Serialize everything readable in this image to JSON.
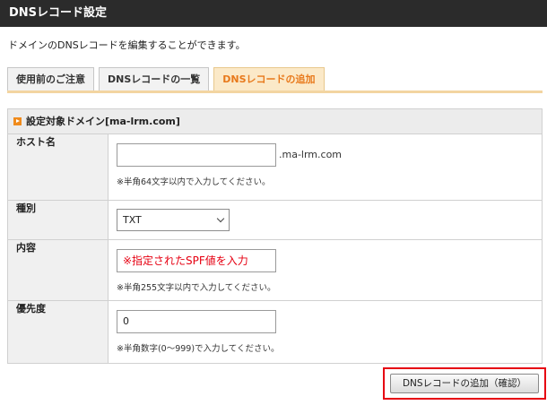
{
  "header": {
    "title": "DNSレコード設定"
  },
  "intro": "ドメインのDNSレコードを編集することができます。",
  "tabs": [
    {
      "label": "使用前のご注意",
      "active": false
    },
    {
      "label": "DNSレコードの一覧",
      "active": false
    },
    {
      "label": "DNSレコードの追加",
      "active": true
    }
  ],
  "section": {
    "title": "設定対象ドメイン[ma-lrm.com]"
  },
  "form": {
    "host": {
      "label": "ホスト名",
      "value": "",
      "suffix": ".ma-lrm.com",
      "hint": "※半角64文字以内で入力してください。"
    },
    "type": {
      "label": "種別",
      "selected": "TXT"
    },
    "content": {
      "label": "内容",
      "value": "※指定されたSPF値を入力",
      "hint": "※半角255文字以内で入力してください。"
    },
    "priority": {
      "label": "優先度",
      "value": "0",
      "hint": "※半角数字(0～999)で入力してください。"
    }
  },
  "confirm_button": {
    "label": "DNSレコードの追加（確認）"
  },
  "colors": {
    "header_bg": "#2b2b2b",
    "active_tab": "#e8791b",
    "highlight": "#e60012"
  }
}
